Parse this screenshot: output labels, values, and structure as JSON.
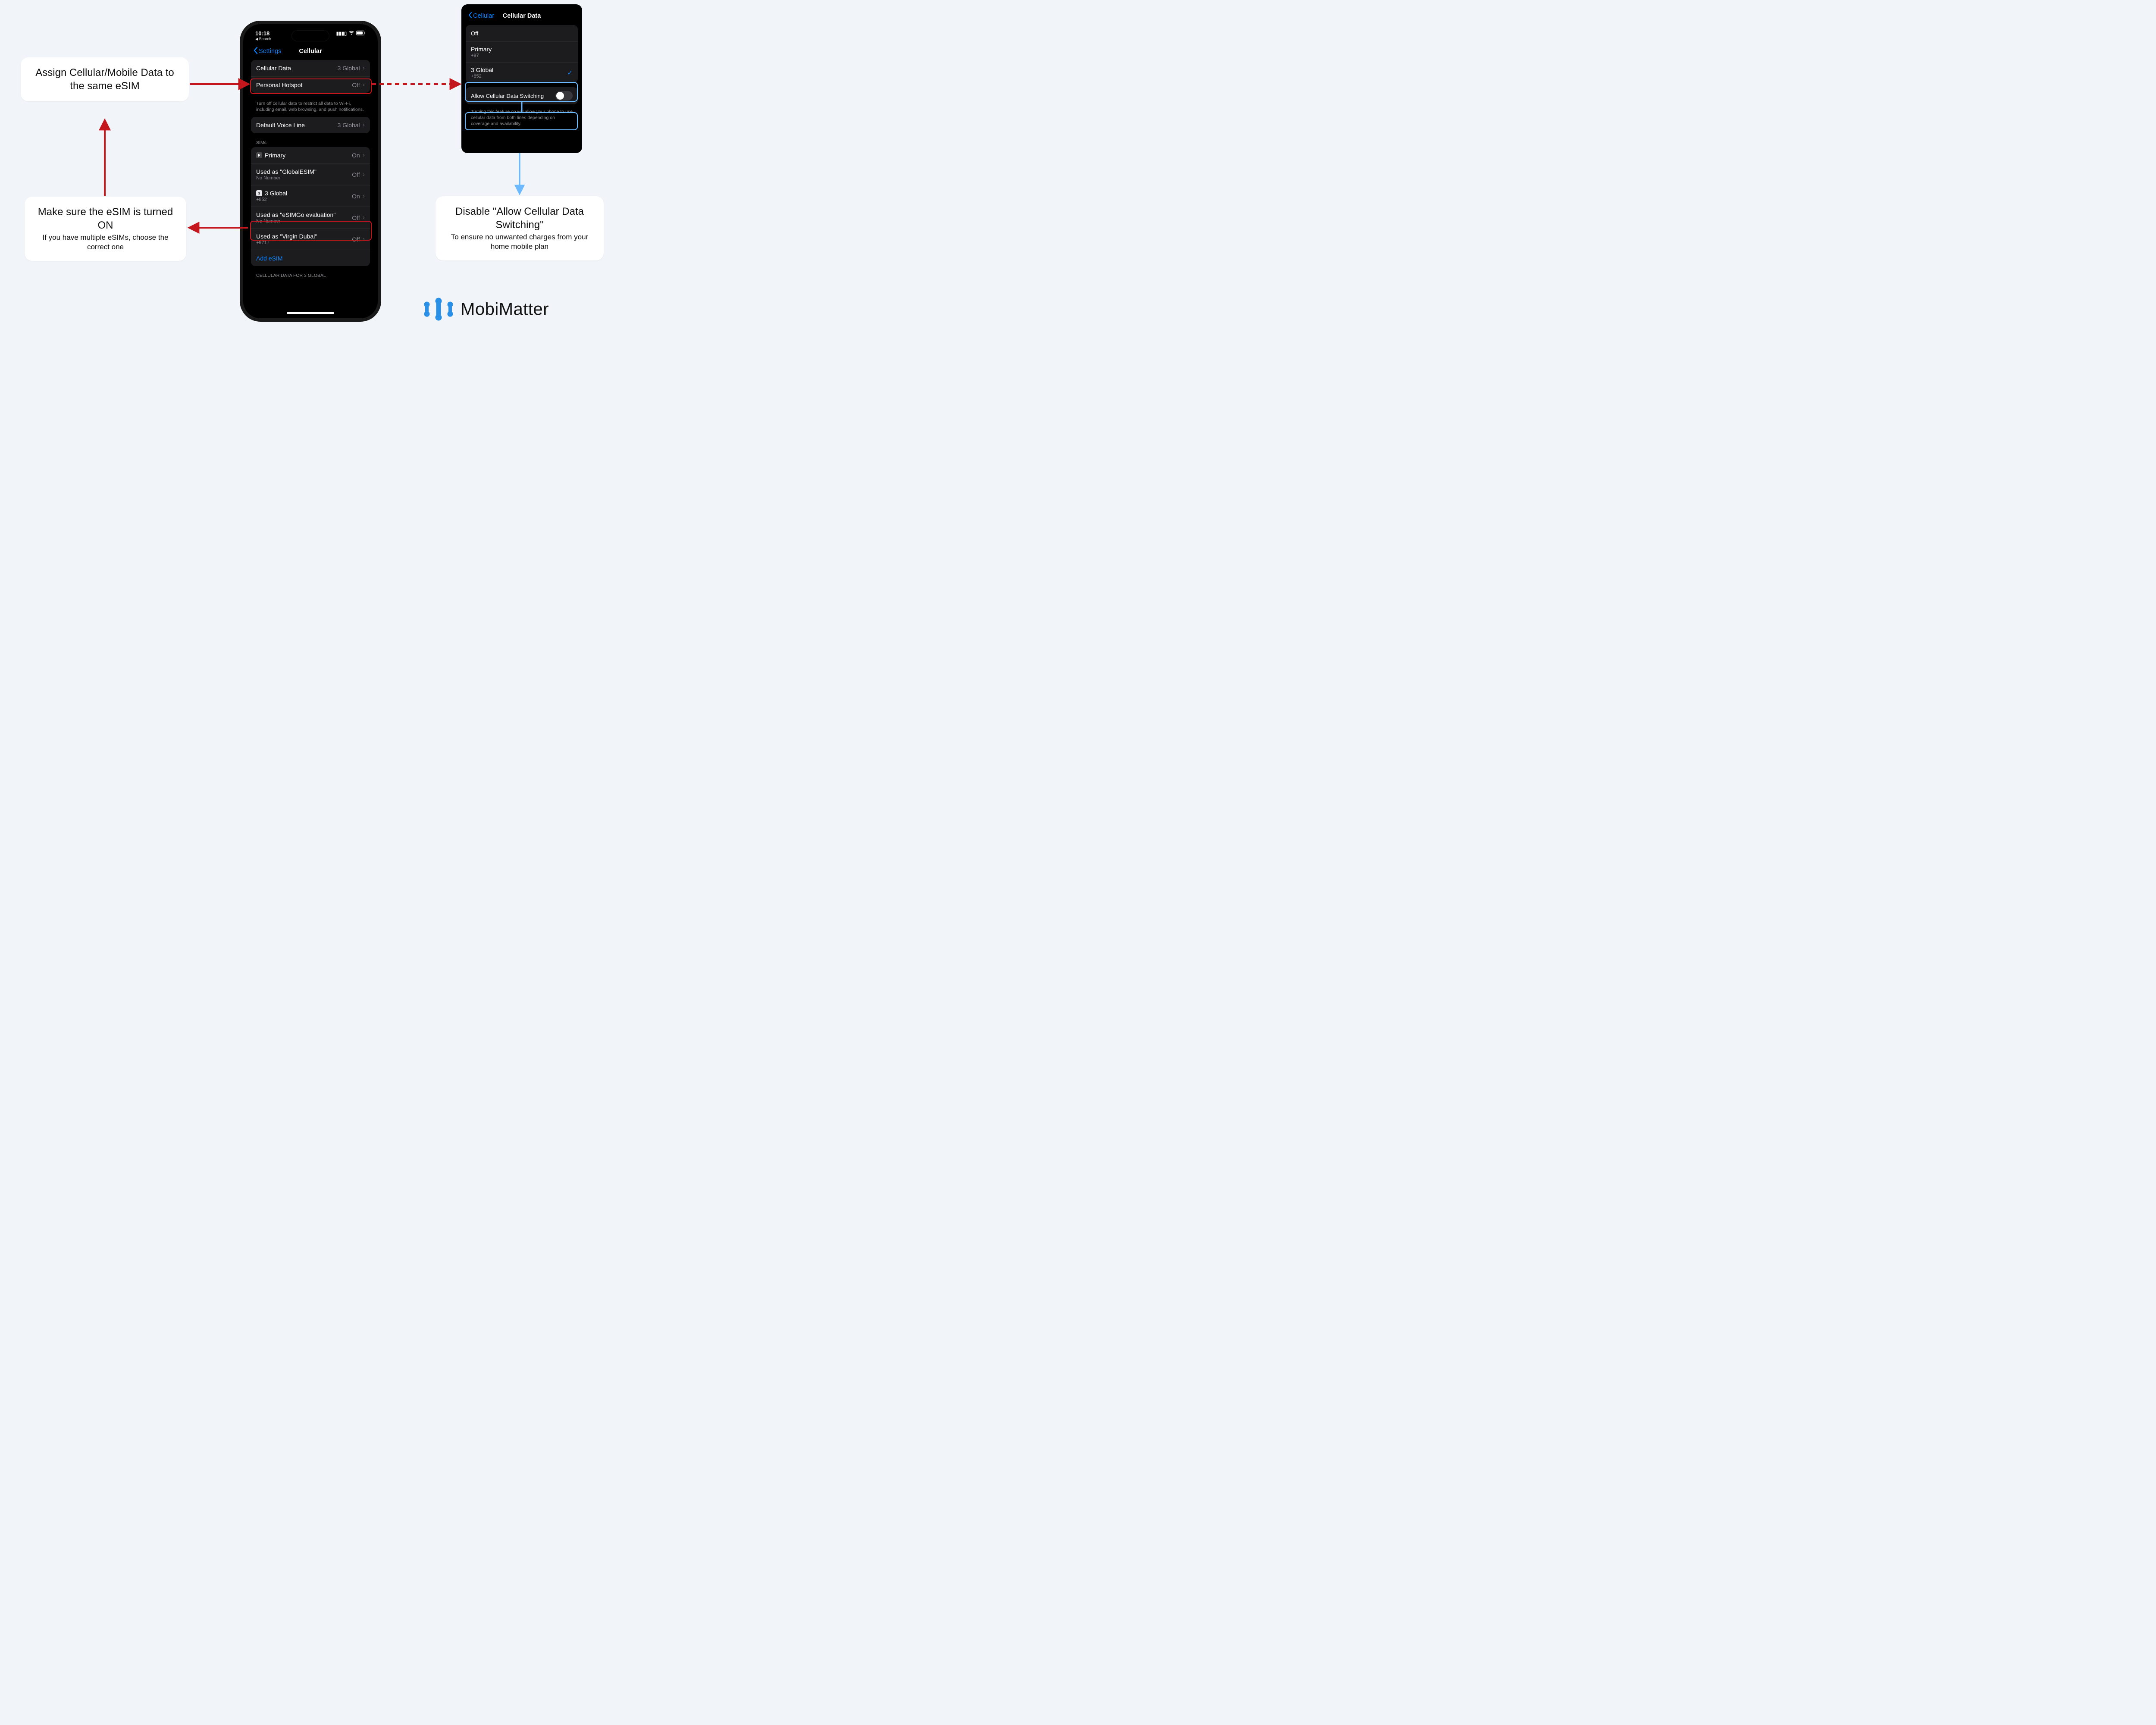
{
  "callouts": {
    "assign": {
      "title": "Assign Cellular/Mobile Data to the same eSIM"
    },
    "on": {
      "title": "Make sure the eSIM is turned ON",
      "sub": "If you have multiple eSIMs, choose the correct one"
    },
    "disable": {
      "title": "Disable \"Allow Cellular Data Switching\"",
      "sub": "To ensure no unwanted charges from your home mobile plan"
    }
  },
  "phone": {
    "status": {
      "time": "10:18",
      "back_search": "Search"
    },
    "nav": {
      "back": "Settings",
      "title": "Cellular"
    },
    "rows": {
      "cellular_data": {
        "label": "Cellular Data",
        "value": "3 Global"
      },
      "hotspot": {
        "label": "Personal Hotspot",
        "value": "Off"
      },
      "hint": "Turn off cellular data to restrict all data to Wi-Fi, including email, web browsing, and push notifications.",
      "default_voice": {
        "label": "Default Voice Line",
        "value": "3 Global"
      }
    },
    "sims_label": "SIMs",
    "sims": [
      {
        "badge": "P",
        "name": "Primary",
        "number": "",
        "state": "On"
      },
      {
        "badge": "",
        "name": "Used as \"GlobalESIM\"",
        "number": "No Number",
        "state": "Off"
      },
      {
        "badge": "3",
        "name": "3 Global",
        "number": "+852",
        "state": "On"
      },
      {
        "badge": "",
        "name": "Used as \"eSIMGo evaluation\"",
        "number": "No Number",
        "state": "Off"
      },
      {
        "badge": "",
        "name": "Used as \"Virgin Dubai\"",
        "number": "+971 !",
        "state": "Off"
      }
    ],
    "add_esim": "Add eSIM",
    "footer_label": "CELLULAR DATA FOR 3 GLOBAL"
  },
  "panel": {
    "nav": {
      "back": "Cellular",
      "title": "Cellular Data"
    },
    "options": {
      "off": "Off",
      "primary": {
        "name": "Primary",
        "number": "+97"
      },
      "global": {
        "name": "3 Global",
        "number": "+852"
      }
    },
    "switch_label": "Allow Cellular Data Switching",
    "switch_hint": "Turning this feature on will allow your phone to use cellular data from both lines depending on coverage and availability."
  },
  "logo": {
    "text": "MobiMatter"
  },
  "colors": {
    "red": "#c4171d",
    "blue": "#6cb9ff",
    "ios_blue": "#0a84ff",
    "logo_blue": "#2a8fe6"
  }
}
